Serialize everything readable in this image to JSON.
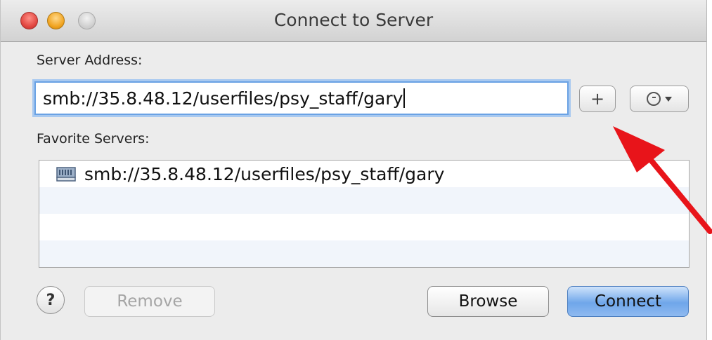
{
  "window": {
    "title": "Connect to Server"
  },
  "server_address": {
    "label": "Server Address:",
    "value": "smb://35.8.48.12/userfiles/psy_staff/gary"
  },
  "favorites": {
    "label": "Favorite Servers:",
    "items": [
      {
        "label": "smb://35.8.48.12/userfiles/psy_staff/gary",
        "icon": "server-drive-icon"
      }
    ]
  },
  "buttons": {
    "add": "+",
    "help": "?",
    "remove": "Remove",
    "browse": "Browse",
    "connect": "Connect"
  },
  "colors": {
    "focus_ring": "#6aa2e4",
    "default_button": "#6fa6ea",
    "annotation_arrow": "#e8141a"
  }
}
